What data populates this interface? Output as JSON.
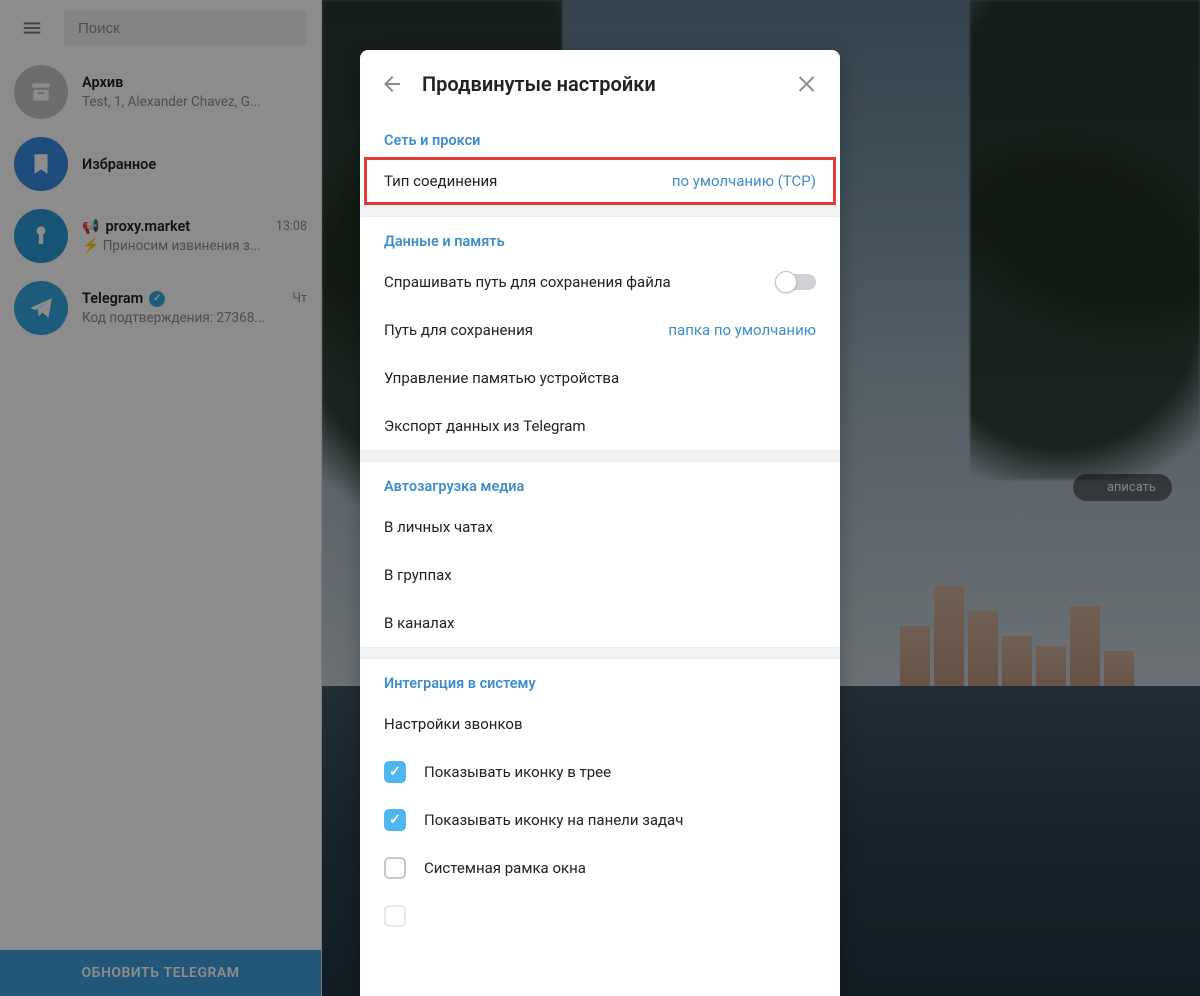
{
  "sidebar": {
    "search_placeholder": "Поиск",
    "chats": [
      {
        "title": "Архив",
        "subtitle": "Test, 1, Alexander Chavez, G...",
        "time": ""
      },
      {
        "title": "Избранное",
        "subtitle": "",
        "time": ""
      },
      {
        "title": "proxy.market",
        "subtitle": "Приносим извинения з...",
        "time": "13:08",
        "megaphone": true,
        "bolt": true
      },
      {
        "title": "Telegram",
        "subtitle": "Код подтверждения: 27368...",
        "time": "Чт",
        "verified": true
      }
    ],
    "update_label": "ОБНОВИТЬ TELEGRAM"
  },
  "chat_area": {
    "write_label": "аписать"
  },
  "modal": {
    "title": "Продвинутые настройки",
    "sections": {
      "network": {
        "header": "Сеть и прокси",
        "connection_type_label": "Тип соединения",
        "connection_type_value": "по умолчанию (TCP)"
      },
      "data": {
        "header": "Данные и память",
        "ask_path_label": "Спрашивать путь для сохранения файла",
        "save_path_label": "Путь для сохранения",
        "save_path_value": "папка по умолчанию",
        "memory_label": "Управление памятью устройства",
        "export_label": "Экспорт данных из Telegram"
      },
      "media": {
        "header": "Автозагрузка медиа",
        "private_label": "В личных чатах",
        "groups_label": "В группах",
        "channels_label": "В каналах"
      },
      "system": {
        "header": "Интеграция в систему",
        "calls_label": "Настройки звонков",
        "tray_label": "Показывать иконку в трее",
        "taskbar_label": "Показывать иконку на панели задач",
        "frame_label": "Системная рамка окна"
      }
    },
    "highlight_number": "3"
  }
}
